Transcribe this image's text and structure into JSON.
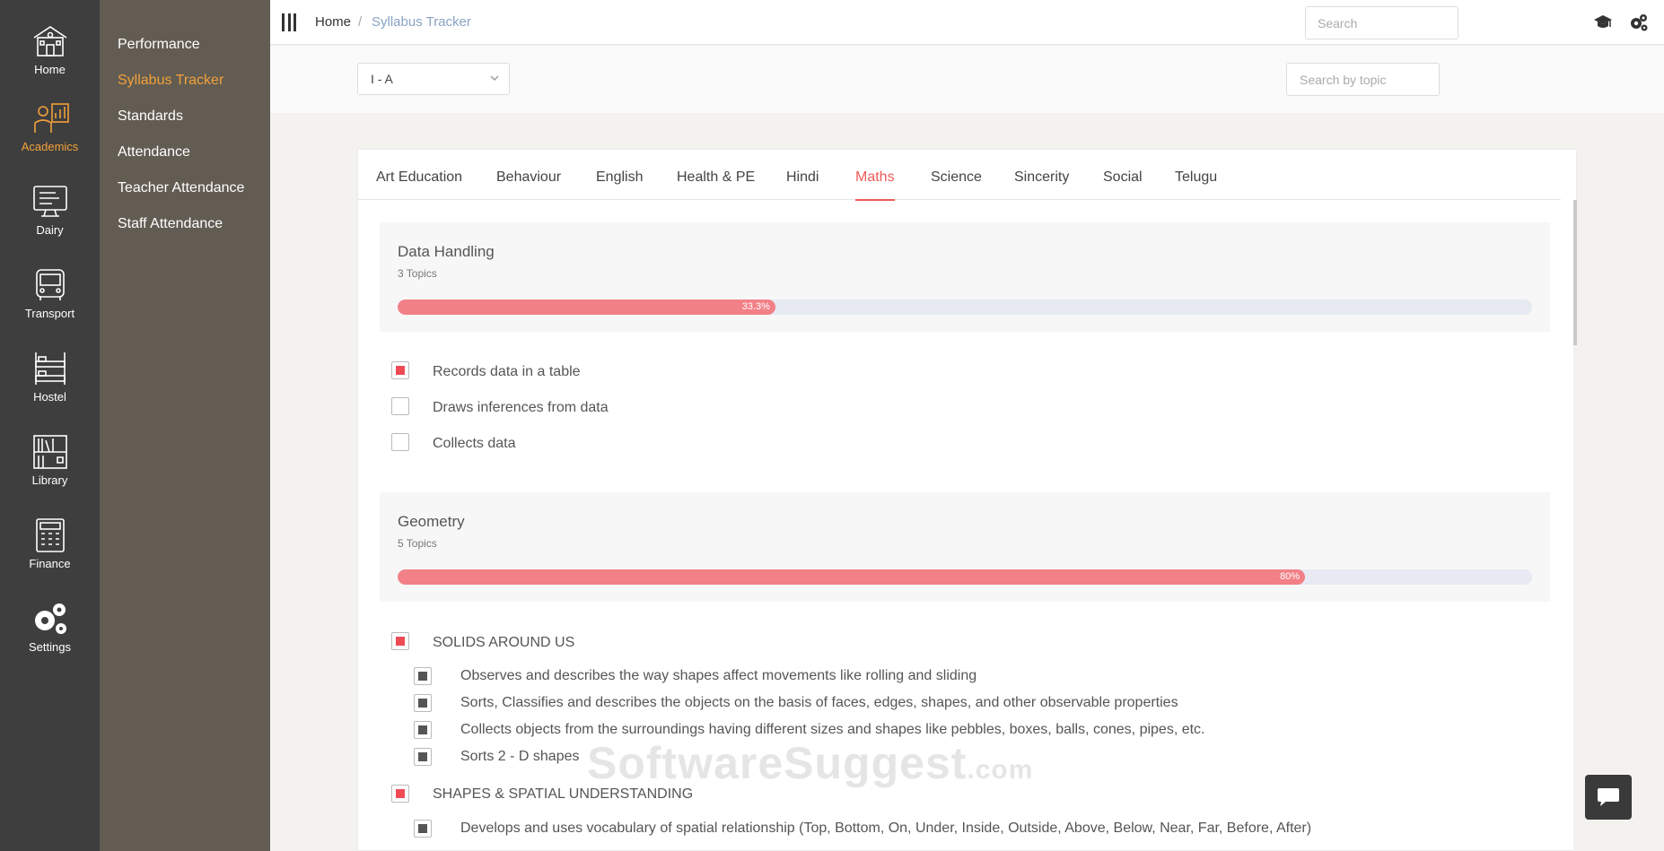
{
  "rail": [
    {
      "label": "Home",
      "icon": "school-icon"
    },
    {
      "label": "Academics",
      "icon": "teacher-icon",
      "active": true
    },
    {
      "label": "Dairy",
      "icon": "monitor-icon"
    },
    {
      "label": "Transport",
      "icon": "bus-icon"
    },
    {
      "label": "Hostel",
      "icon": "bunk-bed-icon"
    },
    {
      "label": "Library",
      "icon": "bookshelf-icon"
    },
    {
      "label": "Finance",
      "icon": "calculator-icon"
    },
    {
      "label": "Settings",
      "icon": "gears-icon"
    }
  ],
  "submenu": [
    "Performance",
    "Syllabus Tracker",
    "Standards",
    "Attendance",
    "Teacher Attendance",
    "Staff Attendance"
  ],
  "breadcrumb": {
    "home": "Home",
    "separator": "/",
    "current": "Syllabus Tracker"
  },
  "header": {
    "search_placeholder": "Search"
  },
  "filters": {
    "class_value": "I - A",
    "topic_placeholder": "Search by topic"
  },
  "tabs": [
    "Art Education",
    "Behaviour",
    "English",
    "Health & PE",
    "Hindi",
    "Maths",
    "Science",
    "Sincerity",
    "Social",
    "Telugu"
  ],
  "active_tab": "Maths",
  "sections": [
    {
      "title": "Data Handling",
      "count": "3 Topics",
      "progress": 33.3,
      "progress_label": "33.3%",
      "items": [
        {
          "text": "Records data in a table",
          "checked": true
        },
        {
          "text": "Draws inferences from data",
          "checked": false
        },
        {
          "text": "Collects data",
          "checked": false
        }
      ]
    },
    {
      "title": "Geometry",
      "count": "5 Topics",
      "progress": 80,
      "progress_label": "80%",
      "items": [
        {
          "text": "SOLIDS AROUND US",
          "checked": true
        },
        {
          "text": "Observes and describes the way shapes affect movements like rolling and sliding",
          "checked": true,
          "sub": true
        },
        {
          "text": "Sorts, Classifies and describes the objects on the basis of faces, edges, shapes, and other observable properties",
          "checked": true,
          "sub": true
        },
        {
          "text": "Collects objects from the surroundings having different sizes and shapes like pebbles, boxes, balls, cones, pipes, etc.",
          "checked": true,
          "sub": true
        },
        {
          "text": "Sorts 2 - D shapes",
          "checked": true,
          "sub": true
        },
        {
          "text": "SHAPES & SPATIAL UNDERSTANDING",
          "checked": true
        },
        {
          "text": "Develops and uses vocabulary of spatial relationship (Top, Bottom, On, Under, Inside, Outside, Above, Below, Near, Far, Before, After)",
          "checked": true,
          "sub": true
        }
      ]
    }
  ],
  "watermark": {
    "main": "SoftwareSuggest",
    "suffix": ".com"
  },
  "colors": {
    "accent": "#ef5a5a",
    "highlight": "#f2a13b",
    "rail": "#3e3e3e",
    "submenu": "#625c52"
  }
}
